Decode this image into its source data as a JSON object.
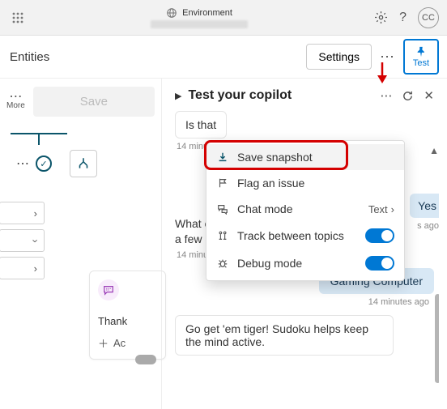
{
  "topbar": {
    "env_label": "Environment",
    "avatar_initials": "CC"
  },
  "row2": {
    "title": "Entities",
    "settings": "Settings",
    "test": "Test"
  },
  "left": {
    "more": "More",
    "save": "Save",
    "msg_card_text": "Thank",
    "add_label": "Ac"
  },
  "panel": {
    "title": "Test your copilot"
  },
  "dropdown": {
    "save_snapshot": "Save snapshot",
    "flag_issue": "Flag an issue",
    "chat_mode": "Chat mode",
    "chat_mode_value": "Text",
    "track_topics": "Track between topics",
    "debug_mode": "Debug mode"
  },
  "chat": {
    "q1": "Is that",
    "ts1": "14 minutes ago",
    "yes_fragment": "Yes",
    "ago_fragment": "s ago",
    "bot1": "What on purchasing? We are focused on a few quality items.",
    "ts2": "14 minutes ago",
    "reply1": "Gaming Computer",
    "ts3": "14 minutes ago",
    "bot2": "Go get 'em tiger! Sudoku helps keep the mind active."
  }
}
